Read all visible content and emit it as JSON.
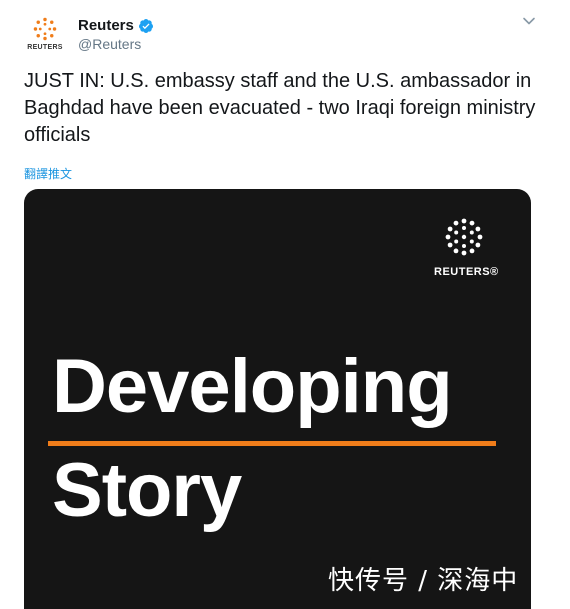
{
  "account": {
    "name": "Reuters",
    "handle": "@Reuters",
    "avatar_label": "REUTERS",
    "verified": true
  },
  "tweet": {
    "text": "JUST IN: U.S. embassy staff and the U.S. ambassador in Baghdad have been evacuated - two Iraqi foreign ministry officials",
    "translate_label": "翻譯推文"
  },
  "media": {
    "logo_text": "REUTERS®",
    "headline_line1": "Developing",
    "headline_line2": "Story",
    "accent_color": "#f07d1a",
    "background_color": "#151515"
  },
  "watermark": "快传号 / 深海中",
  "icons": {
    "verified": "verified-badge-icon",
    "menu": "chevron-down-icon",
    "logo": "reuters-dot-logo-icon"
  }
}
